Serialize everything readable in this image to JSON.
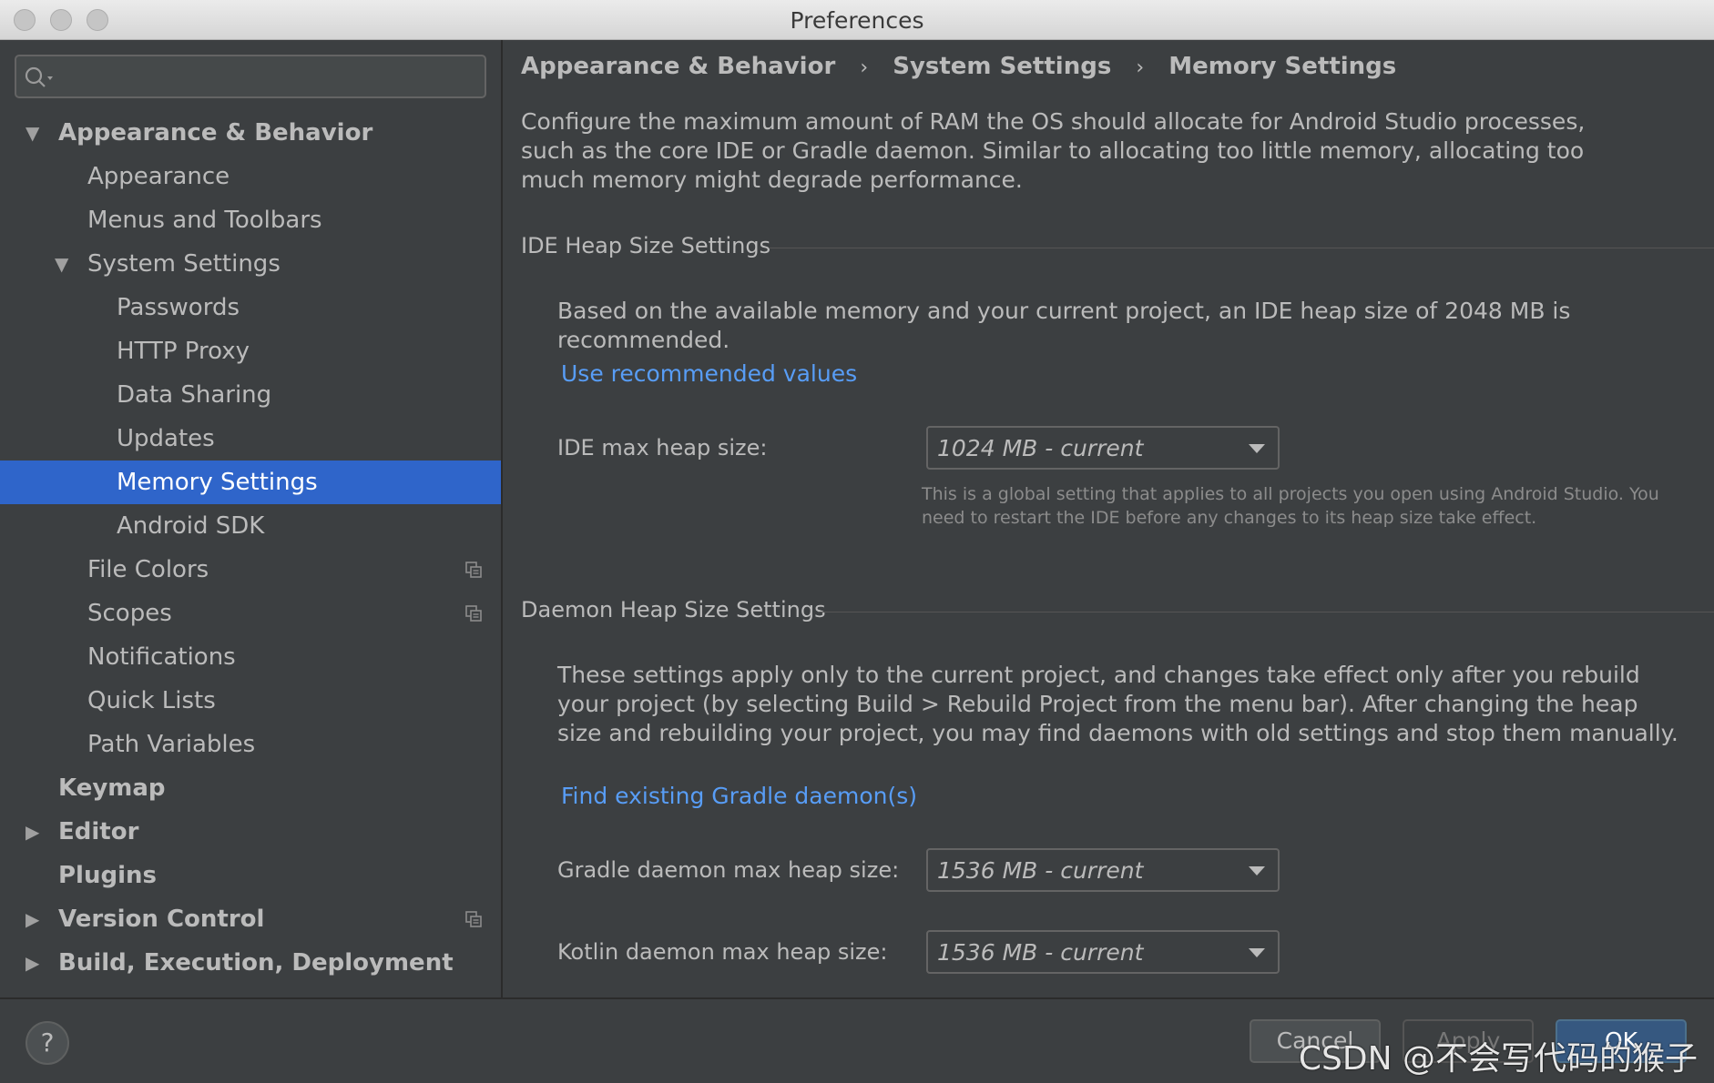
{
  "window": {
    "title": "Preferences"
  },
  "search": {
    "placeholder": "",
    "value": ""
  },
  "sidebar": {
    "items": [
      {
        "label": "Appearance & Behavior",
        "expanded": true
      },
      {
        "label": "Appearance"
      },
      {
        "label": "Menus and Toolbars"
      },
      {
        "label": "System Settings",
        "expanded": true
      },
      {
        "label": "Passwords"
      },
      {
        "label": "HTTP Proxy"
      },
      {
        "label": "Data Sharing"
      },
      {
        "label": "Updates"
      },
      {
        "label": "Memory Settings",
        "selected": true
      },
      {
        "label": "Android SDK"
      },
      {
        "label": "File Colors",
        "icon": "copy-icon"
      },
      {
        "label": "Scopes",
        "icon": "copy-icon"
      },
      {
        "label": "Notifications"
      },
      {
        "label": "Quick Lists"
      },
      {
        "label": "Path Variables"
      },
      {
        "label": "Keymap"
      },
      {
        "label": "Editor",
        "expanded": false
      },
      {
        "label": "Plugins"
      },
      {
        "label": "Version Control",
        "expanded": false,
        "icon": "copy-icon"
      },
      {
        "label": "Build, Execution, Deployment",
        "expanded": false
      }
    ]
  },
  "breadcrumb": {
    "items": [
      "Appearance & Behavior",
      "System Settings",
      "Memory Settings"
    ],
    "separator": "›"
  },
  "main": {
    "intro": "Configure the maximum amount of RAM the OS should allocate for Android Studio processes, such as the core IDE or Gradle daemon. Similar to allocating too little memory, allocating too much memory might degrade performance.",
    "ide_section": {
      "title": "IDE Heap Size Settings",
      "recommendation": "Based on the available memory and your current project, an IDE heap size of 2048 MB is recommended.",
      "link": "Use recommended values",
      "field_label": "IDE max heap size:",
      "field_value": "1024 MB - current",
      "hint": "This is a global setting that applies to all projects you open using Android Studio. You need to restart the IDE before any changes to its heap size take effect."
    },
    "daemon_section": {
      "title": "Daemon Heap Size Settings",
      "description": "These settings apply only to the current project, and changes take effect only after you rebuild your project (by selecting Build > Rebuild Project from the menu bar). After changing the heap size and rebuilding your project, you may find daemons with old settings and stop them manually.",
      "link": "Find existing Gradle daemon(s)",
      "gradle_label": "Gradle daemon max heap size:",
      "gradle_value": "1536 MB - current",
      "kotlin_label": "Kotlin daemon max heap size:",
      "kotlin_value": "1536 MB - current"
    }
  },
  "footer": {
    "help": "?",
    "cancel": "Cancel",
    "apply": "Apply",
    "ok": "OK",
    "watermark": "CSDN @不会写代码的猴子"
  },
  "colors": {
    "background": "#3c3f41",
    "selection": "#2f65ca",
    "link": "#589df6",
    "text": "#bbbbbb"
  }
}
